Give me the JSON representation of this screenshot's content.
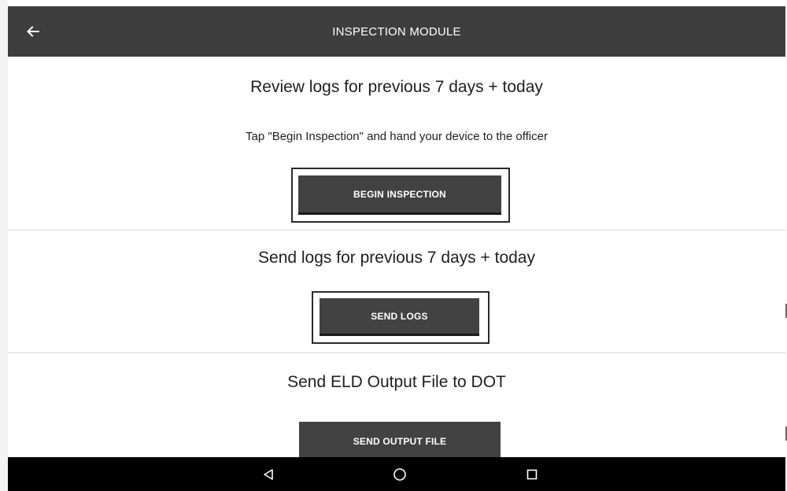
{
  "app_bar": {
    "title": "INSPECTION MODULE",
    "back_icon": "arrow-left-icon"
  },
  "sections": [
    {
      "title": "Review logs for previous 7 days + today",
      "instruction": "Tap \"Begin Inspection\" and hand your device to the officer",
      "button_label": "BEGIN INSPECTION",
      "focused": true
    },
    {
      "title": "Send logs for previous 7 days + today",
      "button_label": "SEND LOGS",
      "focused": true
    },
    {
      "title": "Send ELD Output File to DOT",
      "button_label": "SEND OUTPUT FILE",
      "focused": false
    }
  ],
  "nav_bar": {
    "back_icon": "triangle-back-icon",
    "home_icon": "circle-home-icon",
    "recents_icon": "square-recents-icon"
  },
  "colors": {
    "app_bar": "#3e3e3e",
    "button": "#424242",
    "nav_bar": "#000000",
    "background": "#ffffff"
  }
}
